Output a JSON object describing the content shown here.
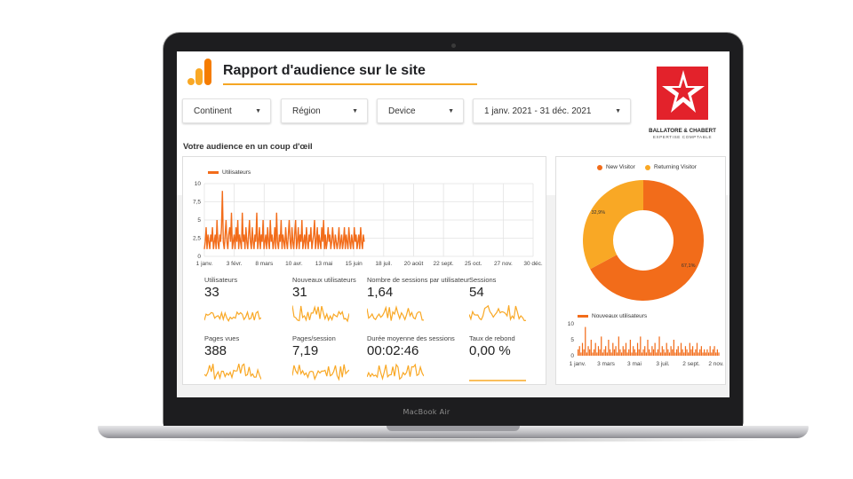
{
  "device": {
    "brand_label": "MacBook Air"
  },
  "report": {
    "title": "Rapport d'audience sur le site",
    "section_title": "Votre audience en un coup d'œil"
  },
  "filters": [
    {
      "label": "Continent"
    },
    {
      "label": "Région"
    },
    {
      "label": "Device"
    },
    {
      "label": "1 janv. 2021 - 31 déc. 2021"
    }
  ],
  "company": {
    "name": "BALLATORE & CHABERT",
    "subtitle": "EXPERTISE COMPTABLE"
  },
  "colors": {
    "orange": "#f26c1a",
    "light_orange": "#f9a825",
    "accent_line": "#f5a623",
    "logo_red": "#e3222b"
  },
  "metrics": [
    {
      "label": "Utilisateurs",
      "value": "33"
    },
    {
      "label": "Nouveaux utilisateurs",
      "value": "31"
    },
    {
      "label": "Nombre de sessions par utilisateur",
      "value": "1,64"
    },
    {
      "label": "Sessions",
      "value": "54"
    },
    {
      "label": "Pages vues",
      "value": "388"
    },
    {
      "label": "Pages/session",
      "value": "7,19"
    },
    {
      "label": "Durée moyenne des sessions",
      "value": "00:02:46"
    },
    {
      "label": "Taux de rebond",
      "value": "0,00 %"
    }
  ],
  "chart_data": [
    {
      "type": "line",
      "series": [
        {
          "name": "Utilisateurs",
          "values": [
            1,
            2,
            4,
            1,
            3,
            2,
            1,
            3,
            2,
            4,
            1,
            2,
            3,
            1,
            5,
            2,
            1,
            3,
            2,
            4,
            9,
            2,
            1,
            3,
            5,
            2,
            1,
            3,
            4,
            2,
            6,
            1,
            2,
            3,
            1,
            4,
            2,
            5,
            1,
            3,
            2,
            1,
            6,
            2,
            3,
            1,
            4,
            2,
            1,
            3,
            5,
            2,
            1,
            4,
            2,
            1,
            3,
            2,
            6,
            1,
            2,
            4,
            1,
            3,
            2,
            5,
            1,
            2,
            3,
            1,
            4,
            2,
            1,
            5,
            2,
            3,
            1,
            2,
            4,
            1,
            6,
            2,
            1,
            3,
            2,
            5,
            1,
            3,
            2,
            1,
            4,
            2,
            1,
            3,
            5,
            2,
            1,
            4,
            2,
            1,
            3,
            5,
            1,
            2,
            4,
            1,
            3,
            2,
            5,
            1,
            2,
            3,
            1,
            4,
            2,
            1,
            3,
            2,
            4,
            1,
            2,
            3,
            5,
            1,
            2,
            4,
            1,
            3,
            2,
            1,
            4,
            2,
            5,
            1,
            3,
            1,
            2,
            4,
            2,
            3,
            1,
            2,
            4,
            2,
            1,
            3,
            2,
            1,
            2,
            4,
            1,
            2,
            3,
            1,
            2,
            4,
            1,
            3,
            2,
            1,
            4,
            2,
            1,
            3,
            2,
            1,
            4,
            2,
            3,
            1,
            2,
            3,
            1,
            4,
            2,
            1,
            3,
            2
          ]
        }
      ],
      "x_ticks": [
        "1 janv.",
        "3 févr.",
        "8 mars",
        "10 avr.",
        "13 mai",
        "15 juin",
        "18 juil.",
        "20 août",
        "22 sept.",
        "25 oct.",
        "27 nov.",
        "30 déc."
      ],
      "y_ticks": [
        "0",
        "2,5",
        "5",
        "7,5",
        "10"
      ],
      "ylim": [
        0,
        10
      ],
      "grid": true,
      "legend": "top-left"
    },
    {
      "type": "pie",
      "series": [
        {
          "name": "New Visitor",
          "value": 67.1,
          "label": "67,1%",
          "color": "#f26c1a"
        },
        {
          "name": "Returning Visitor",
          "value": 32.9,
          "label": "32,9%",
          "color": "#f9a825"
        }
      ],
      "legend": "top"
    },
    {
      "type": "bar",
      "series": [
        {
          "name": "Nouveaux utilisateurs",
          "values": [
            2,
            3,
            1,
            4,
            2,
            9,
            1,
            3,
            2,
            5,
            1,
            2,
            4,
            1,
            3,
            2,
            6,
            1,
            2,
            3,
            1,
            5,
            2,
            1,
            4,
            2,
            3,
            1,
            6,
            2,
            1,
            3,
            2,
            4,
            1,
            2,
            5,
            1,
            3,
            2,
            1,
            4,
            2,
            6,
            1,
            2,
            3,
            1,
            5,
            2,
            1,
            3,
            2,
            4,
            1,
            2,
            6,
            1,
            3,
            2,
            1,
            4,
            2,
            1,
            3,
            2,
            5,
            1,
            2,
            3,
            1,
            4,
            2,
            1,
            3,
            2,
            1,
            4,
            2,
            3,
            1,
            2,
            4,
            1,
            2,
            3,
            1,
            2,
            1,
            2,
            1,
            3,
            1,
            2,
            3,
            1,
            2,
            1
          ]
        }
      ],
      "x_ticks": [
        "1 janv.",
        "3 mars",
        "3 mai",
        "3 juil.",
        "2 sept.",
        "2 nov."
      ],
      "y_ticks": [
        "0",
        "5",
        "10"
      ],
      "ylim": [
        0,
        10
      ],
      "legend": "top-left"
    }
  ]
}
